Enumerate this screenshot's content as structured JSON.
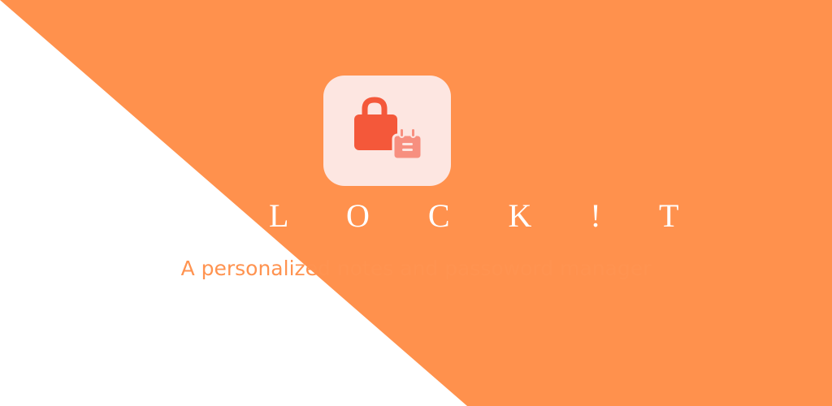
{
  "app": {
    "name": "L O C K ! T",
    "tagline": "A personalized notes and passoword manager"
  },
  "logo": {
    "icon": "lock-with-notepad-icon",
    "tile_color": "#fde6e1",
    "lock_color": "#f4583a",
    "notepad_color": "#f78f7f"
  },
  "colors": {
    "background_left": "#ffffff",
    "background_right": "#ff914d",
    "title": "#ffffff",
    "tagline": "#ff9350"
  }
}
